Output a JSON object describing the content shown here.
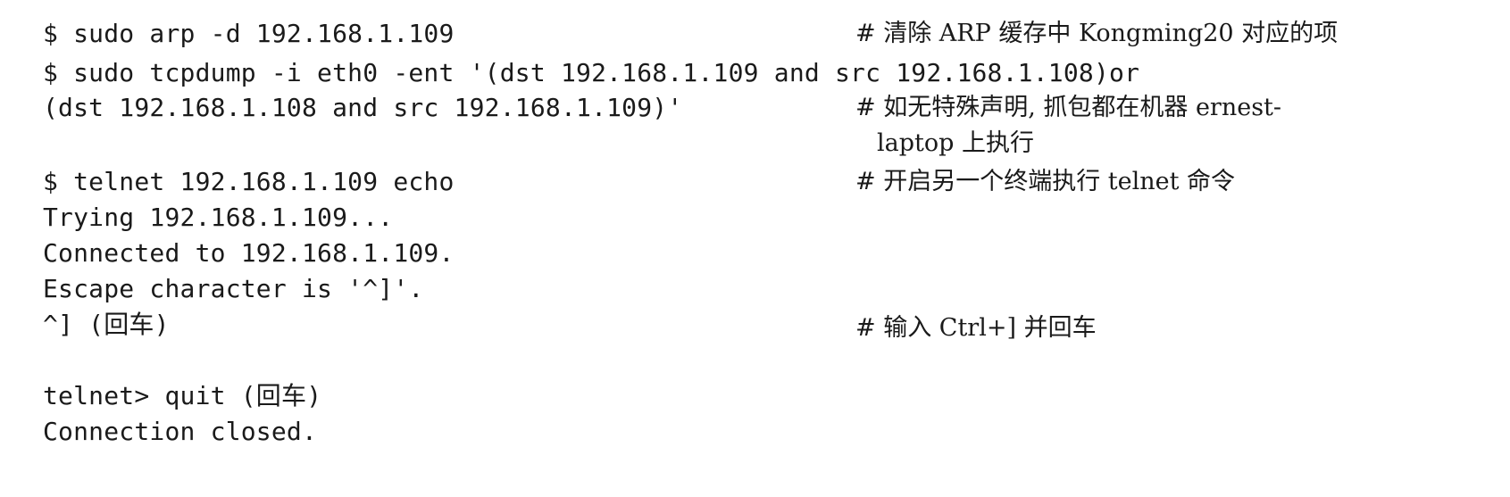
{
  "lines": {
    "l1": "$ sudo arp -d 192.168.1.109",
    "l2": "$ sudo tcpdump -i eth0 -ent '(dst 192.168.1.109 and src 192.168.1.108)or",
    "l3": "(dst 192.168.1.108 and src 192.168.1.109)'",
    "l4": "$ telnet 192.168.1.109 echo",
    "l5": "Trying 192.168.1.109...",
    "l6": "Connected to 192.168.1.109.",
    "l7": "Escape character is '^]'.",
    "l8": "^] (回车)",
    "l9": "telnet> quit (回车)",
    "l10": "Connection closed."
  },
  "comments": {
    "c1": "# 清除 ARP 缓存中 Kongming20 对应的项",
    "c2a": "# 如无特殊声明, 抓包都在机器 ernest-",
    "c2b": "laptop 上执行",
    "c3": "# 开启另一个终端执行 telnet 命令",
    "c4": "# 输入 Ctrl+] 并回车"
  }
}
